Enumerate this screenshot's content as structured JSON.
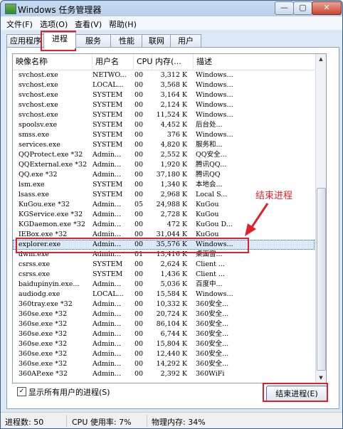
{
  "window": {
    "title": "Windows 任务管理器"
  },
  "controls": {
    "min": "—",
    "max": "▢",
    "close": "✕"
  },
  "menu": [
    "文件(F)",
    "选项(O)",
    "查看(V)",
    "帮助(H)"
  ],
  "tabs": [
    "应用程序",
    "进程",
    "服务",
    "性能",
    "联网",
    "用户"
  ],
  "active_tab": "进程",
  "columns": [
    "映像名称",
    "用户名",
    "CPU",
    "内存(...",
    "描述"
  ],
  "processes": [
    {
      "name": "svchost.exe",
      "user": "NETWO...",
      "cpu": "00",
      "mem": "3,312 K",
      "desc": "Windows..."
    },
    {
      "name": "svchost.exe",
      "user": "LOCAL...",
      "cpu": "00",
      "mem": "3,568 K",
      "desc": "Windows..."
    },
    {
      "name": "svchost.exe",
      "user": "SYSTEM",
      "cpu": "00",
      "mem": "3,164 K",
      "desc": "Windows..."
    },
    {
      "name": "svchost.exe",
      "user": "SYSTEM",
      "cpu": "00",
      "mem": "2,124 K",
      "desc": "Windows..."
    },
    {
      "name": "svchost.exe",
      "user": "SYSTEM",
      "cpu": "00",
      "mem": "11,524 K",
      "desc": "Windows..."
    },
    {
      "name": "spoolsv.exe",
      "user": "SYSTEM",
      "cpu": "00",
      "mem": "4,452 K",
      "desc": "后台处..."
    },
    {
      "name": "smss.exe",
      "user": "SYSTEM",
      "cpu": "00",
      "mem": "376 K",
      "desc": "Windows..."
    },
    {
      "name": "services.exe",
      "user": "SYSTEM",
      "cpu": "00",
      "mem": "4,820 K",
      "desc": "服务和..."
    },
    {
      "name": "QQProtect.exe *32",
      "user": "Admin...",
      "cpu": "00",
      "mem": "2,552 K",
      "desc": "QQ安全..."
    },
    {
      "name": "QQExternal.exe *32",
      "user": "Admin...",
      "cpu": "00",
      "mem": "1,920 K",
      "desc": "腾讯QQ..."
    },
    {
      "name": "QQ.exe *32",
      "user": "Admin...",
      "cpu": "00",
      "mem": "37,180 K",
      "desc": "腾讯QQ"
    },
    {
      "name": "lsm.exe",
      "user": "SYSTEM",
      "cpu": "00",
      "mem": "1,340 K",
      "desc": "本地会..."
    },
    {
      "name": "lsass.exe",
      "user": "SYSTEM",
      "cpu": "00",
      "mem": "2,968 K",
      "desc": "Local S..."
    },
    {
      "name": "KuGou.exe *32",
      "user": "Admin...",
      "cpu": "05",
      "mem": "24,988 K",
      "desc": "KuGou"
    },
    {
      "name": "KGService.exe *32",
      "user": "Admin...",
      "cpu": "00",
      "mem": "2,728 K",
      "desc": "KuGou"
    },
    {
      "name": "KGDaemon.exe *32",
      "user": "Admin...",
      "cpu": "00",
      "mem": "472 K",
      "desc": "KuGou D..."
    },
    {
      "name": "IEBox.exe *32",
      "user": "Admin...",
      "cpu": "00",
      "mem": "31,044 K",
      "desc": "KuGou"
    },
    {
      "name": "explorer.exe",
      "user": "Admin...",
      "cpu": "00",
      "mem": "35,576 K",
      "desc": "Windows..."
    },
    {
      "name": "dwm.exe",
      "user": "Admin...",
      "cpu": "01",
      "mem": "13,416 K",
      "desc": "桌面窗..."
    },
    {
      "name": "csrss.exe",
      "user": "SYSTEM",
      "cpu": "00",
      "mem": "2,624 K",
      "desc": "Client ..."
    },
    {
      "name": "csrss.exe",
      "user": "SYSTEM",
      "cpu": "00",
      "mem": "1,436 K",
      "desc": "Client ..."
    },
    {
      "name": "baidupinyin.exe...",
      "user": "Admin...",
      "cpu": "00",
      "mem": "5,036 K",
      "desc": "百度中..."
    },
    {
      "name": "audiodg.exe",
      "user": "LOCAL...",
      "cpu": "00",
      "mem": "15,584 K",
      "desc": "Windows..."
    },
    {
      "name": "360tray.exe *32",
      "user": "Admin...",
      "cpu": "00",
      "mem": "10,332 K",
      "desc": "360安全..."
    },
    {
      "name": "360se.exe *32",
      "user": "Admin...",
      "cpu": "00",
      "mem": "20,724 K",
      "desc": "360安全..."
    },
    {
      "name": "360se.exe *32",
      "user": "Admin...",
      "cpu": "00",
      "mem": "86,104 K",
      "desc": "360安全..."
    },
    {
      "name": "360se.exe *32",
      "user": "Admin...",
      "cpu": "00",
      "mem": "6,744 K",
      "desc": "360安全..."
    },
    {
      "name": "360se.exe *32",
      "user": "Admin...",
      "cpu": "00",
      "mem": "15,804 K",
      "desc": "360安全..."
    },
    {
      "name": "360se.exe *32",
      "user": "Admin...",
      "cpu": "00",
      "mem": "12,440 K",
      "desc": "360安全..."
    },
    {
      "name": "360se.exe *32",
      "user": "Admin...",
      "cpu": "00",
      "mem": "14,292 K",
      "desc": "360安全..."
    },
    {
      "name": "360AP.exe *32",
      "user": "Admin...",
      "cpu": "00",
      "mem": "2,392 K",
      "desc": "360WiFi"
    }
  ],
  "selected_index": 17,
  "annotation": "结束进程",
  "show_all_users": {
    "label": "显示所有用户的进程(S)",
    "checked": true
  },
  "end_process_button": "结束进程(E)",
  "status": {
    "process_count": "进程数: 50",
    "cpu_usage": "CPU 使用率: 7%",
    "memory": "物理内存: 34%"
  },
  "colors": {
    "highlight": "#e0212c",
    "selection": "#dbe8f7"
  }
}
